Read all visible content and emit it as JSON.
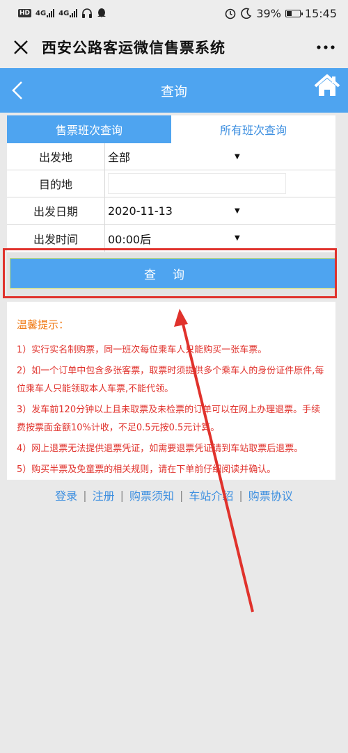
{
  "status_bar": {
    "badge": "HD",
    "network_1": "4G",
    "network_2": "4G",
    "battery": "39%",
    "time": "15:45"
  },
  "wechat": {
    "title": "西安公路客运微信售票系统",
    "close_icon": "close-icon",
    "more_icon": "more-icon"
  },
  "header": {
    "title": "查询",
    "back_icon": "back-icon",
    "home_icon": "home-icon"
  },
  "tabs": [
    {
      "label": "售票班次查询",
      "active": true
    },
    {
      "label": "所有班次查询",
      "active": false
    }
  ],
  "form": {
    "departure_label": "出发地",
    "departure_value": "全部",
    "destination_label": "目的地",
    "destination_value": "",
    "date_label": "出发日期",
    "date_value": "2020-11-13",
    "time_label": "出发时间",
    "time_value": "00:00后"
  },
  "query_button": "查询",
  "notice": {
    "title": "温馨提示：",
    "items": [
      "1）实行实名制购票，同一班次每位乘车人只能购买一张车票。",
      "2）如一个订单中包含多张客票，取票时须提供多个乘车人的身份证件原件,每位乘车人只能领取本人车票,不能代领。",
      "3）发车前120分钟以上且未取票及未检票的订单可以在网上办理退票。手续费按票面金额10%计收，不足0.5元按0.5元计算。",
      "4）网上退票无法提供退票凭证，如需要退票凭证请到车站取票后退票。",
      "5）购买半票及免童票的相关规则，请在下单前仔细阅读并确认。"
    ]
  },
  "footer_links": [
    "登录",
    "注册",
    "购票须知",
    "车站介绍",
    "购票协议"
  ],
  "footer_separator": "|",
  "colors": {
    "accent": "#4ea4f0",
    "highlight": "#e0322c",
    "notice_title": "#f07d1a",
    "notice_text": "#e0322c",
    "link": "#3d8fe0"
  }
}
